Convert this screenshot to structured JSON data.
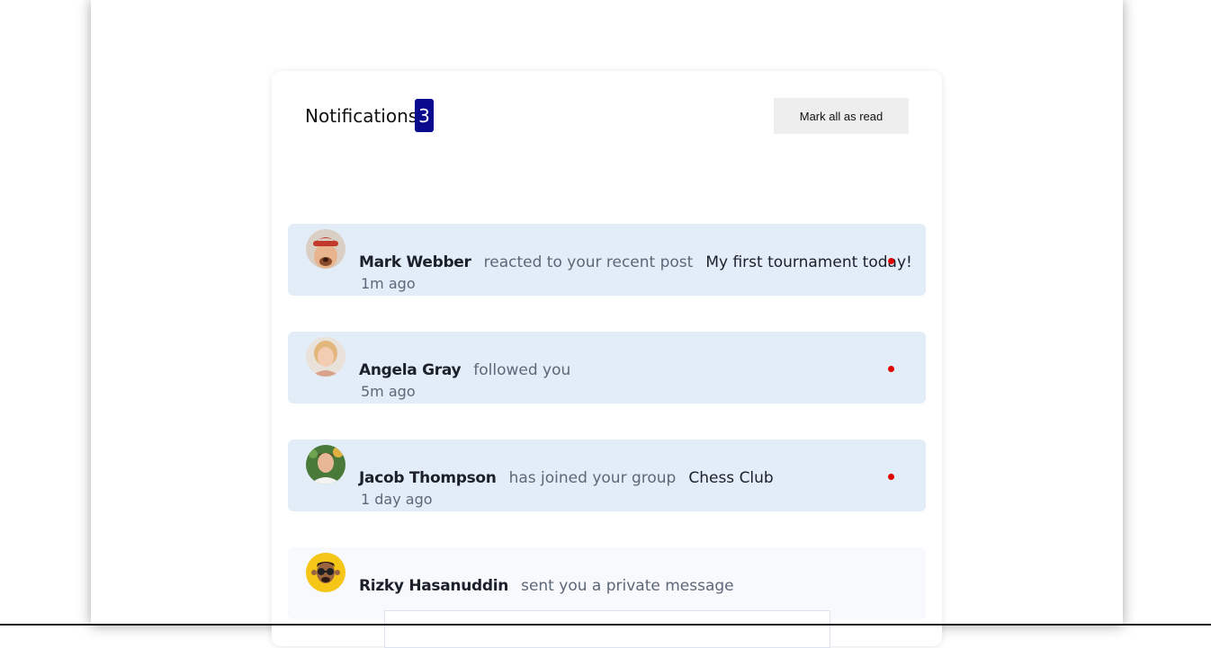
{
  "header": {
    "title": "Notifications",
    "unread_count": "3",
    "mark_all_label": "Mark all as read"
  },
  "colors": {
    "badge": "#0a0a8e",
    "unread_bg": "#e3edf8",
    "read_bg": "#f7f9fd",
    "unread_dot": "#e00000"
  },
  "notifications": [
    {
      "name": "Mark Webber",
      "action": "reacted to your recent post",
      "target": "My first tournament today!",
      "time": "1m ago",
      "unread": true,
      "avatar": "avatar-mark-webber"
    },
    {
      "name": "Angela Gray",
      "action": "followed you",
      "target": "",
      "time": "5m ago",
      "unread": true,
      "avatar": "avatar-angela-gray"
    },
    {
      "name": "Jacob Thompson",
      "action": "has joined your group",
      "target": "Chess Club",
      "time": "1 day ago",
      "unread": true,
      "avatar": "avatar-jacob-thompson"
    },
    {
      "name": "Rizky Hasanuddin",
      "action": "sent you a private message",
      "target": "",
      "time": "",
      "unread": false,
      "avatar": "avatar-rizky-hasanuddin"
    }
  ]
}
